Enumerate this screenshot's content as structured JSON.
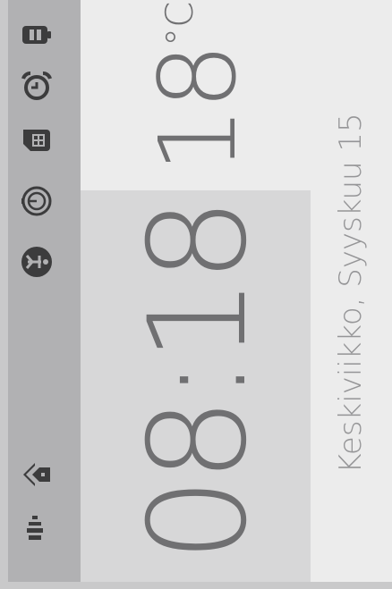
{
  "status_bar": {
    "icons": [
      "battery-icon",
      "alarm-clock-icon",
      "sim-card-icon",
      "timer-icon",
      "accessibility-icon"
    ],
    "bottom_icons": [
      "home-icon",
      "signal-strength-icon"
    ]
  },
  "weather": {
    "temperature": "18",
    "unit": "°C"
  },
  "clock": {
    "time": "08:18"
  },
  "date": {
    "text": "Keskiviikko, Syyskuu 15"
  },
  "colors": {
    "sidebar": "#b1b1b3",
    "icon": "#3c3c3d",
    "temp_panel": "#ececec",
    "clock_panel": "#d7d7d8",
    "text": "#707072"
  }
}
